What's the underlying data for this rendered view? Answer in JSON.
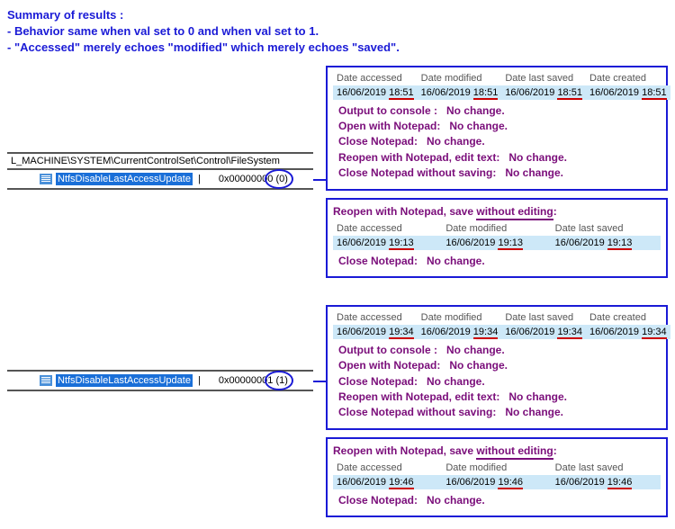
{
  "summary": {
    "title": "Summary of results :",
    "line1": "- Behavior same when val set to 0 and when val set to 1.",
    "line2": "- \"Accessed\" merely echoes \"modified\" which merely echoes \"saved\"."
  },
  "registry": {
    "path": "L_MACHINE\\SYSTEM\\CurrentControlSet\\Control\\FileSystem",
    "name": "NtfsDisableLastAccessUpdate",
    "sep": "|",
    "val0": "0x00000000 (0)",
    "val1": "0x00000001 (1)"
  },
  "headers": {
    "accessed": "Date accessed",
    "modified": "Date modified",
    "saved": "Date last saved",
    "created": "Date created"
  },
  "labels": {
    "output": "Output to console :",
    "open": "Open with Notepad:",
    "close": "Close Notepad:",
    "reopen_edit": "Reopen with Notepad, edit text:",
    "close_nosave": "Close Notepad without saving:",
    "reopen_save_noedit_prefix": "Reopen with Notepad, save ",
    "reopen_save_noedit_under": "without editing",
    "reopen_save_noedit_suffix": ":",
    "nochange": "No change."
  },
  "block0": {
    "row1": {
      "date": "16/06/2019",
      "time": "18:51"
    },
    "row2": {
      "date": "16/06/2019",
      "time": "19:13"
    }
  },
  "block1": {
    "row1": {
      "date": "16/06/2019",
      "time": "19:34"
    },
    "row2": {
      "date": "16/06/2019",
      "time": "19:46"
    }
  }
}
